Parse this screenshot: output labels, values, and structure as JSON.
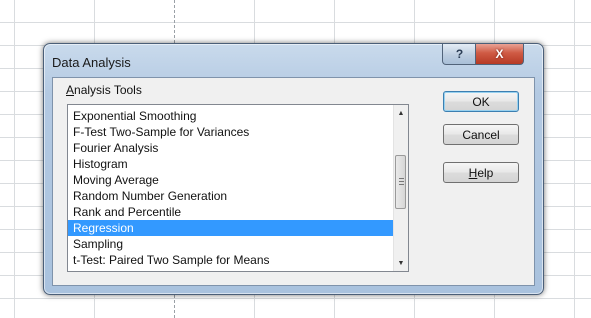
{
  "dialog": {
    "title": "Data Analysis",
    "help_button": "?",
    "close_button": "X"
  },
  "analysis_tools": {
    "label_prefix": "",
    "label_accel": "A",
    "label_rest": "nalysis Tools",
    "items": [
      "Exponential Smoothing",
      "F-Test Two-Sample for Variances",
      "Fourier Analysis",
      "Histogram",
      "Moving Average",
      "Random Number Generation",
      "Rank and Percentile",
      "Regression",
      "Sampling",
      "t-Test: Paired Two Sample for Means"
    ],
    "selected": "Regression"
  },
  "buttons": {
    "ok": "OK",
    "cancel": "Cancel",
    "help_accel": "H",
    "help_rest": "elp"
  }
}
